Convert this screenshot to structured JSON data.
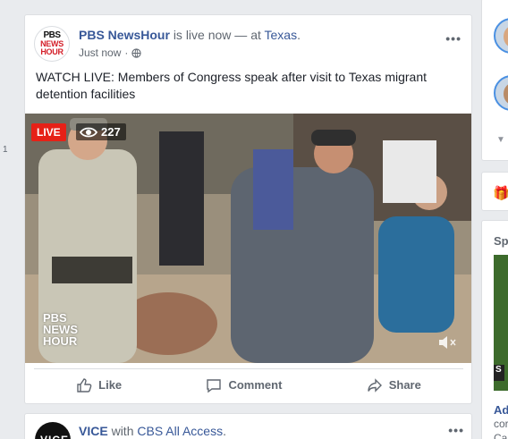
{
  "left_counter": "1",
  "post": {
    "page_name": "PBS NewsHour",
    "status": "is live now",
    "dash": "—",
    "at_word": "at",
    "place": "Texas",
    "period": ".",
    "time": "Just now",
    "dot": "·",
    "text": "WATCH LIVE: Members of Congress speak after visit to Texas migrant detention facilities",
    "avatar_logo": {
      "top": "PBS",
      "mid": "NEWS",
      "bot": "HOUR"
    },
    "video": {
      "live_label": "LIVE",
      "viewer_count": "227",
      "watermark": [
        "PBS",
        "NEWS",
        "HOUR"
      ]
    },
    "actions": {
      "like": "Like",
      "comment": "Comment",
      "share": "Share"
    },
    "more_label": "•••"
  },
  "post2": {
    "page_name": "VICE",
    "with_word": "with",
    "partner": "CBS All Access",
    "period": ".",
    "more_label": "•••"
  },
  "right": {
    "sponsored_fragment": "Sp",
    "ad_title_fragment": "Ad",
    "ad_sub1_fragment": "cor",
    "ad_sub2_fragment": "Ca",
    "ad_badge": "S",
    "gift_emoji": "🎁",
    "chevron": "▼"
  },
  "colors": {
    "link_blue": "#385898",
    "live_red": "#e62117",
    "page_bg": "#e9ebee",
    "muted_text": "#606770"
  }
}
